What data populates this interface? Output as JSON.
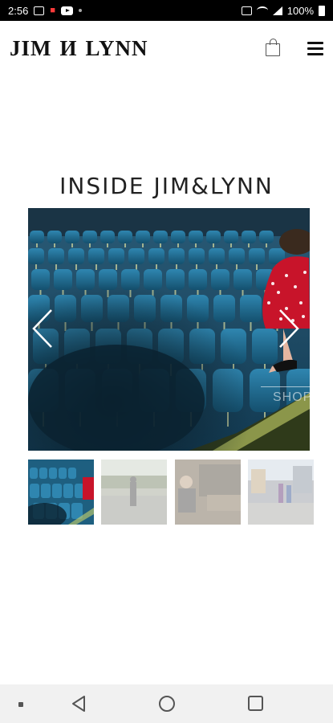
{
  "status_bar": {
    "time": "2:56",
    "battery": "100%",
    "icons": [
      "gallery-icon",
      "notification-icon",
      "youtube-icon",
      "dot-icon",
      "cast-icon",
      "wifi-icon",
      "signal-icon",
      "battery-icon"
    ]
  },
  "header": {
    "logo": "JIM И LYNN",
    "cart_icon": "shopping-bag-icon",
    "menu_icon": "hamburger-menu-icon"
  },
  "section": {
    "title": "INSIDE JIM&LYNN"
  },
  "slideshow": {
    "prev_icon": "chevron-left-icon",
    "next_icon": "chevron-right-icon",
    "shop_label": "SHOP",
    "active_index": 0,
    "thumbnail_count": 4
  },
  "colors": {
    "background": "#ffffff",
    "seat_blue": "#1f6f95",
    "dress_red": "#c8142a",
    "nav_bar": "#f1f1f1"
  },
  "nav_bar": {
    "icons": [
      "dot-icon",
      "back-triangle-icon",
      "home-circle-icon",
      "recents-square-icon"
    ]
  }
}
